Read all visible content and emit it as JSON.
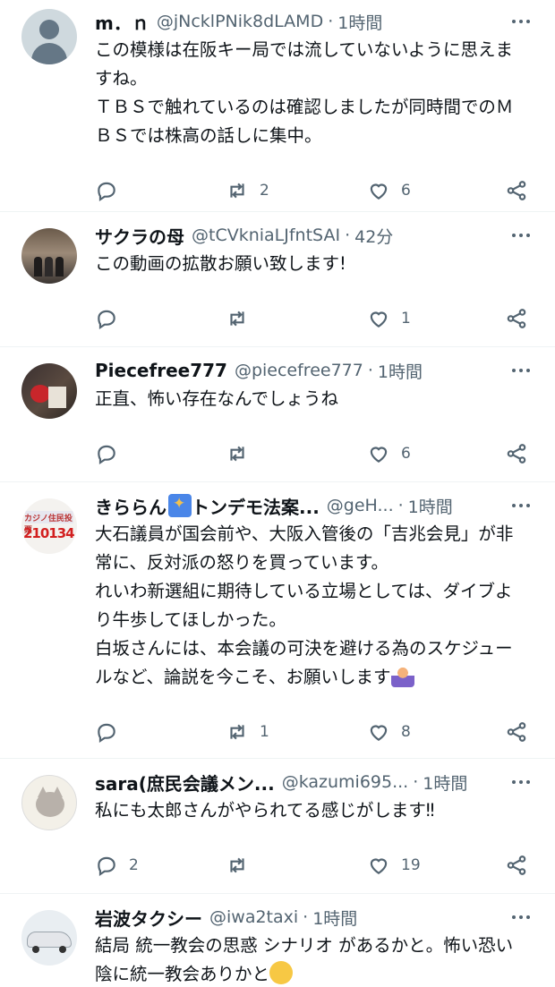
{
  "tweets": [
    {
      "name": "m．ｎ",
      "handle": "@jNcklPNik8dLAMD",
      "time": "1時間",
      "text": "この模様は在阪キー局では流していないように思えますね。\nＴＢＳで触れているのは確認しましたが同時間でのＭＢＳでは株高の話しに集中。",
      "replies": "",
      "retweets": "2",
      "likes": "6",
      "avatar": "default-avatar"
    },
    {
      "name": "サクラの母",
      "handle": "@tCVkniaLJfntSAI",
      "time": "42分",
      "text": "この動画の拡散お願い致します!",
      "replies": "",
      "retweets": "",
      "likes": "1",
      "avatar": "photo-people"
    },
    {
      "name": "Piecefree777",
      "handle": "@piecefree777",
      "time": "1時間",
      "text": "正直、怖い存在なんでしょうね",
      "replies": "",
      "retweets": "",
      "likes": "6",
      "avatar": "photo-flowers"
    },
    {
      "name": "きららん",
      "name_suffix": "トンデモ法案...",
      "handle": "@geH...",
      "time": "1時間",
      "text": "大石議員が国会前や、大阪入管後の「吉兆会見」が非常に、反対派の怒りを買っています。\nれいわ新選組に期待している立場としては、ダイブより牛歩してほしかった。\n白坂さんには、本会議の可決を避ける為のスケジュールなど、論説を今こそ、お願いします",
      "replies": "",
      "retweets": "1",
      "likes": "8",
      "avatar": "sign-avatar",
      "avatar_sign_top": "カジノ住民投票",
      "avatar_sign_num": "210134"
    },
    {
      "name": "sara(庶民会議メン...",
      "handle": "@kazumi695...",
      "time": "1時間",
      "text": "私にも太郎さんがやられてる感じがします‼",
      "replies": "2",
      "retweets": "",
      "likes": "19",
      "avatar": "cat-avatar"
    },
    {
      "name": "岩波タクシー",
      "handle": "@iwa2taxi",
      "time": "1時間",
      "text": "結局 統一教会の思惑 シナリオ があるかと。怖い恐い 陰に統一教会ありかと",
      "avatar": "car-avatar"
    }
  ],
  "dot_sep": "·",
  "colors": {
    "text": "#0f1419",
    "secondary": "#536471",
    "divider": "#eff3f4"
  }
}
